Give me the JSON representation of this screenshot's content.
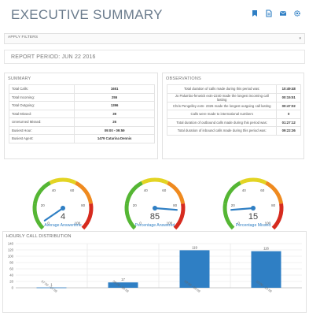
{
  "header": {
    "title": "EXECUTIVE SUMMARY",
    "icons": [
      "bookmark-icon",
      "document-icon",
      "mail-icon",
      "gear-icon"
    ]
  },
  "filters": {
    "label": "APPLY FILTERS"
  },
  "report": {
    "period": "REPORT PERIOD: JUN 22 2016"
  },
  "summary": {
    "title": "SUMMARY",
    "rows": [
      {
        "label": "Total Calls:",
        "value": "1651"
      },
      {
        "label": "Total Incoming:",
        "value": "255"
      },
      {
        "label": "Total Outgoing:",
        "value": "1396"
      },
      {
        "label": "Total Missed:",
        "value": "39"
      },
      {
        "label": "Unreturned Missed:",
        "value": "26"
      },
      {
        "label": "Busiest Hour:",
        "value": "09:00 - 09:59"
      },
      {
        "label": "Busiest Agent:",
        "value": "1479 Catarina Dennis"
      }
    ]
  },
  "observations": {
    "title": "OBSERVATIONS",
    "rows": [
      {
        "label": "Total duration of calls made during this period was:",
        "value": "10:49:48"
      },
      {
        "label": "Jo Palumbo-fenwick extn-2240 made the longest incoming call lasting",
        "value": "00:15:51"
      },
      {
        "label": "Chris Pengelley extn- 2326 made the longest outgoing call lasting",
        "value": "00:47:02"
      },
      {
        "label": "Calls were made to international numbers",
        "value": "0"
      },
      {
        "label": "Total duration of outbound calls made during this period was:",
        "value": "01:27:12"
      },
      {
        "label": "Total duration of inbound calls made during this period was:",
        "value": "09:22:36"
      }
    ]
  },
  "gauges": [
    {
      "label": "Average Answertime",
      "value": 4,
      "value_text": "4",
      "max": 100,
      "ticks": [
        "0",
        "20",
        "40",
        "60",
        "80",
        "100"
      ]
    },
    {
      "label": "Percentage Answered",
      "value": 85,
      "value_text": "85",
      "max": 100,
      "ticks": [
        "0",
        "20",
        "40",
        "60",
        "80",
        "100"
      ]
    },
    {
      "label": "Percentage Missed",
      "value": 15,
      "value_text": "15",
      "max": 100,
      "ticks": [
        "0",
        "20",
        "40",
        "60",
        "80",
        "100"
      ]
    }
  ],
  "colors": {
    "accent": "#2f7fc4",
    "gauge_red": "#d62b1f",
    "gauge_orange": "#ef8a1f",
    "gauge_yellow": "#e3d423",
    "gauge_green": "#55b634",
    "bar": "#2f7fc4"
  },
  "chart_panel": {
    "title": "HOURLY CALL DISTRIBUTION"
  },
  "chart_data": {
    "type": "bar",
    "categories": [
      "07:00 - 07:59",
      "08:00 - 08:59",
      "09:00 - 09:59",
      "10:00 - 10:59"
    ],
    "values": [
      1,
      17,
      119,
      116
    ],
    "value_labels": [
      "1",
      "17",
      "119",
      "116"
    ],
    "ylim": [
      0,
      140
    ],
    "yticks": [
      "0",
      "20",
      "40",
      "60",
      "80",
      "100",
      "120",
      "140"
    ],
    "grid": true
  }
}
